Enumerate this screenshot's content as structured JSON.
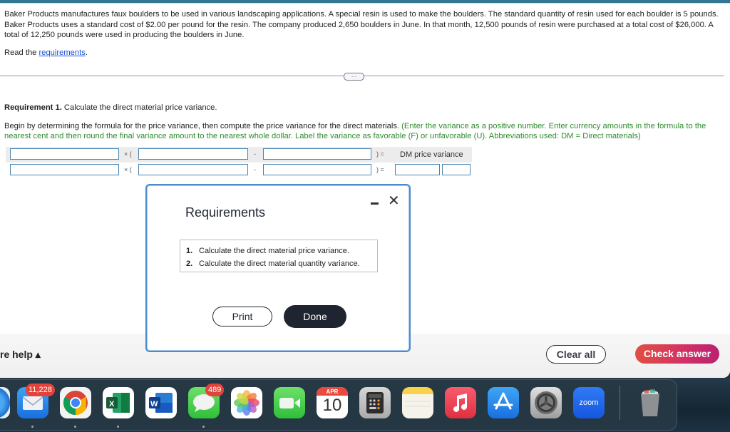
{
  "problem": {
    "text": "Baker Products manufactures faux boulders to be used in various landscaping applications. A special resin is used to make the boulders. The standard quantity of resin used for each boulder is 5 pounds. Baker Products uses a standard cost of $2.00 per pound for the resin. The company produced 2,650 boulders in June. In that month, 12,500 pounds of resin were purchased at a total cost of $26,000. A total of 12,250 pounds were used in producing the boulders in June.",
    "read_prefix": "Read the ",
    "read_link": "requirements",
    "read_suffix": "."
  },
  "more_toggle": "…",
  "requirement": {
    "label": "Requirement 1.",
    "text": " Calculate the direct material price variance.",
    "instruction_black": "Begin by determining the formula for the price variance, then compute the price variance for the direct materials. ",
    "instruction_green": "(Enter the variance as a positive number. Enter currency amounts in the formula to the nearest cent and then round the final variance amount to the nearest whole dollar. Label the variance as favorable (F) or unfavorable (U). Abbreviations used: DM = Direct materials)"
  },
  "formula": {
    "times_open": "× (",
    "minus": "-",
    "close_equals": ")  =",
    "result_label": "DM price variance",
    "row1": {
      "input1": "",
      "input2": "",
      "input3": ""
    },
    "row2": {
      "input1": "",
      "input2": "",
      "input3": "",
      "result": "",
      "label": ""
    }
  },
  "footer": {
    "help": "re help ▴",
    "clear_all": "Clear all",
    "check_answer": "Check answer"
  },
  "modal": {
    "title": "Requirements",
    "minimize": "minimize",
    "close": "✕",
    "items": [
      {
        "num": "1.",
        "text": "Calculate the direct material price variance."
      },
      {
        "num": "2.",
        "text": "Calculate the direct material quantity variance."
      }
    ],
    "print": "Print",
    "done": "Done"
  },
  "dock": {
    "mail_badge": "11,228",
    "messages_badge": "489",
    "calendar_month": "APR",
    "calendar_day": "10",
    "zoom_label": "zoom",
    "apps": [
      "safari",
      "mail",
      "chrome",
      "excel",
      "word",
      "messages",
      "photos",
      "facetime",
      "calendar",
      "calculator",
      "notes",
      "music",
      "app-store",
      "system-preferences",
      "zoom",
      "trash"
    ]
  }
}
